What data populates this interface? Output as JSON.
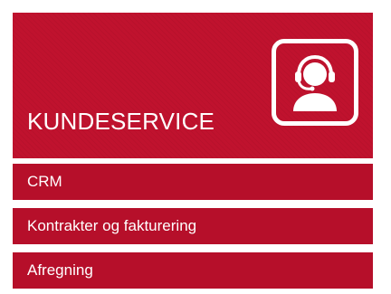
{
  "tile": {
    "title": "KUNDESERVICE",
    "icon": "headset-agent-icon",
    "accent_color": "#c0122e"
  },
  "menu": {
    "items": [
      {
        "label": "CRM"
      },
      {
        "label": "Kontrakter og fakturering"
      },
      {
        "label": "Afregning"
      }
    ],
    "background_color": "#b60f2a",
    "text_color": "#ffffff"
  }
}
